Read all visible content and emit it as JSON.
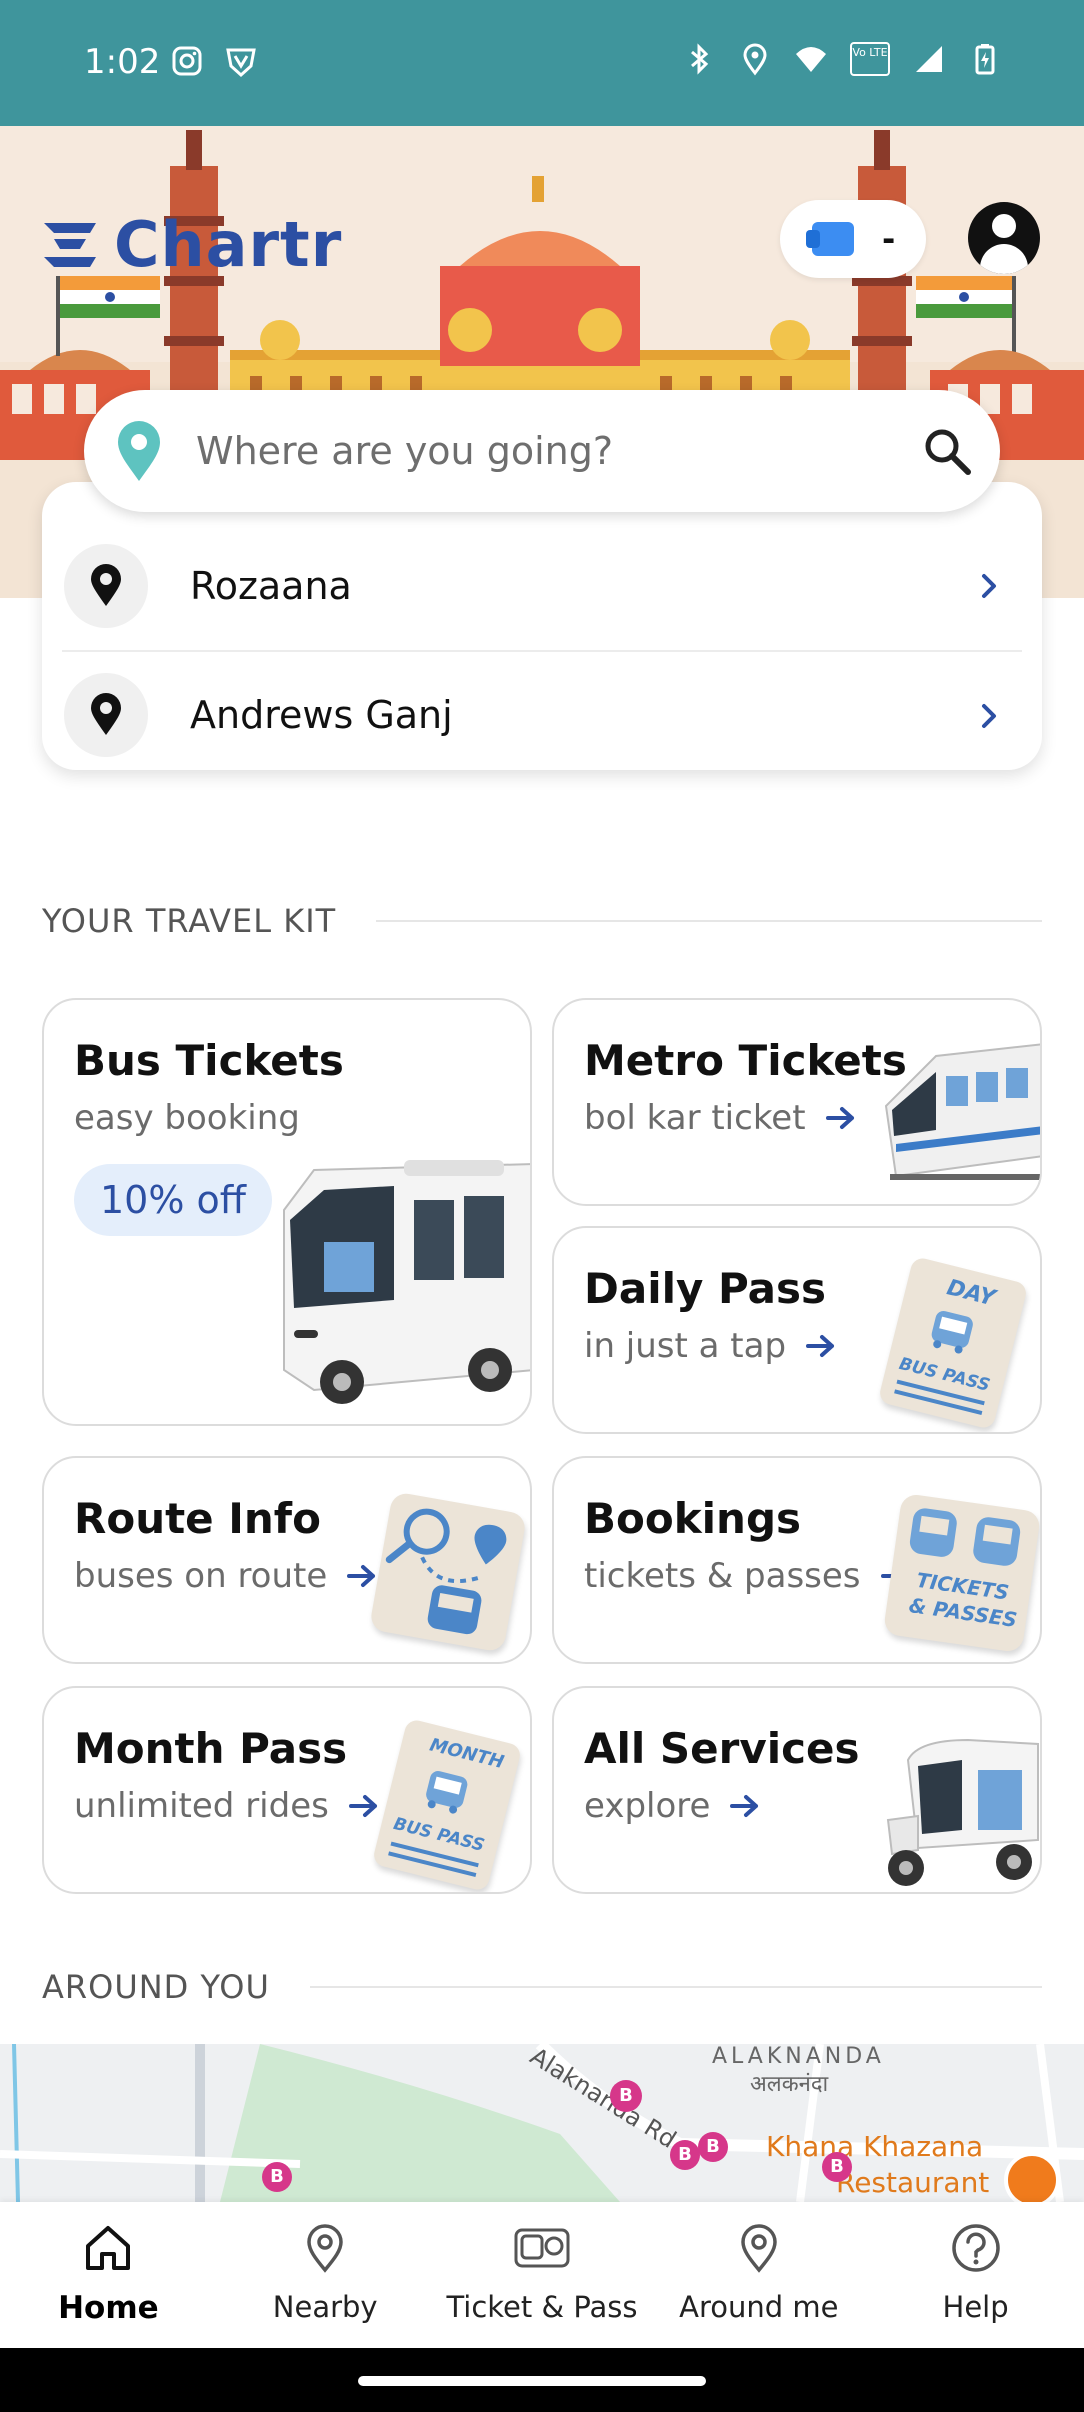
{
  "status_bar": {
    "time": "1:02",
    "left_icons": [
      "instagram-icon",
      "vpn-shield-icon"
    ],
    "right_icons": [
      "bluetooth-icon",
      "location-icon",
      "wifi-icon",
      "volte-icon",
      "signal-icon",
      "battery-charging-icon"
    ],
    "volte_text": "Vo LTE"
  },
  "header": {
    "logo_text": "Chartr",
    "wallet_value": "-",
    "colors": {
      "brand": "#2c4fa3",
      "teal": "#3f959c"
    }
  },
  "search": {
    "placeholder": "Where are you going?"
  },
  "recents": [
    {
      "label": "Rozaana"
    },
    {
      "label": "Andrews Ganj"
    }
  ],
  "travel_kit": {
    "title": "YOUR TRAVEL KIT",
    "cards": {
      "bus": {
        "title": "Bus Tickets",
        "sub": "easy booking",
        "badge": "10% off"
      },
      "metro": {
        "title": "Metro Tickets",
        "sub": "bol kar ticket"
      },
      "daily": {
        "title": "Daily Pass",
        "sub": "in just a tap",
        "art_top": "DAY",
        "art_bottom": "BUS PASS"
      },
      "route": {
        "title": "Route Info",
        "sub": "buses on route"
      },
      "bookings": {
        "title": "Bookings",
        "sub": "tickets & passes",
        "art_top": "TICKETS",
        "art_bottom": "& PASSES"
      },
      "month": {
        "title": "Month Pass",
        "sub": "unlimited rides",
        "art_top": "MONTH",
        "art_bottom": "BUS PASS"
      },
      "services": {
        "title": "All Services",
        "sub": "explore"
      }
    }
  },
  "around_you": {
    "title": "AROUND YOU",
    "map_labels": {
      "area": "ALAKNANDA",
      "area_hindi": "अलकनंदा",
      "road": "Alaknanda Rd",
      "place_line1": "Khana Khazana",
      "place_line2": "Restaurant",
      "bus_stop": "B"
    }
  },
  "bottom_nav": [
    {
      "label": "Home",
      "icon": "home-icon",
      "active": true
    },
    {
      "label": "Nearby",
      "icon": "location-pin-icon",
      "active": false
    },
    {
      "label": "Ticket & Pass",
      "icon": "bus-metro-icon",
      "active": false
    },
    {
      "label": "Around me",
      "icon": "location-pin-icon",
      "active": false
    },
    {
      "label": "Help",
      "icon": "help-circle-icon",
      "active": false
    }
  ]
}
